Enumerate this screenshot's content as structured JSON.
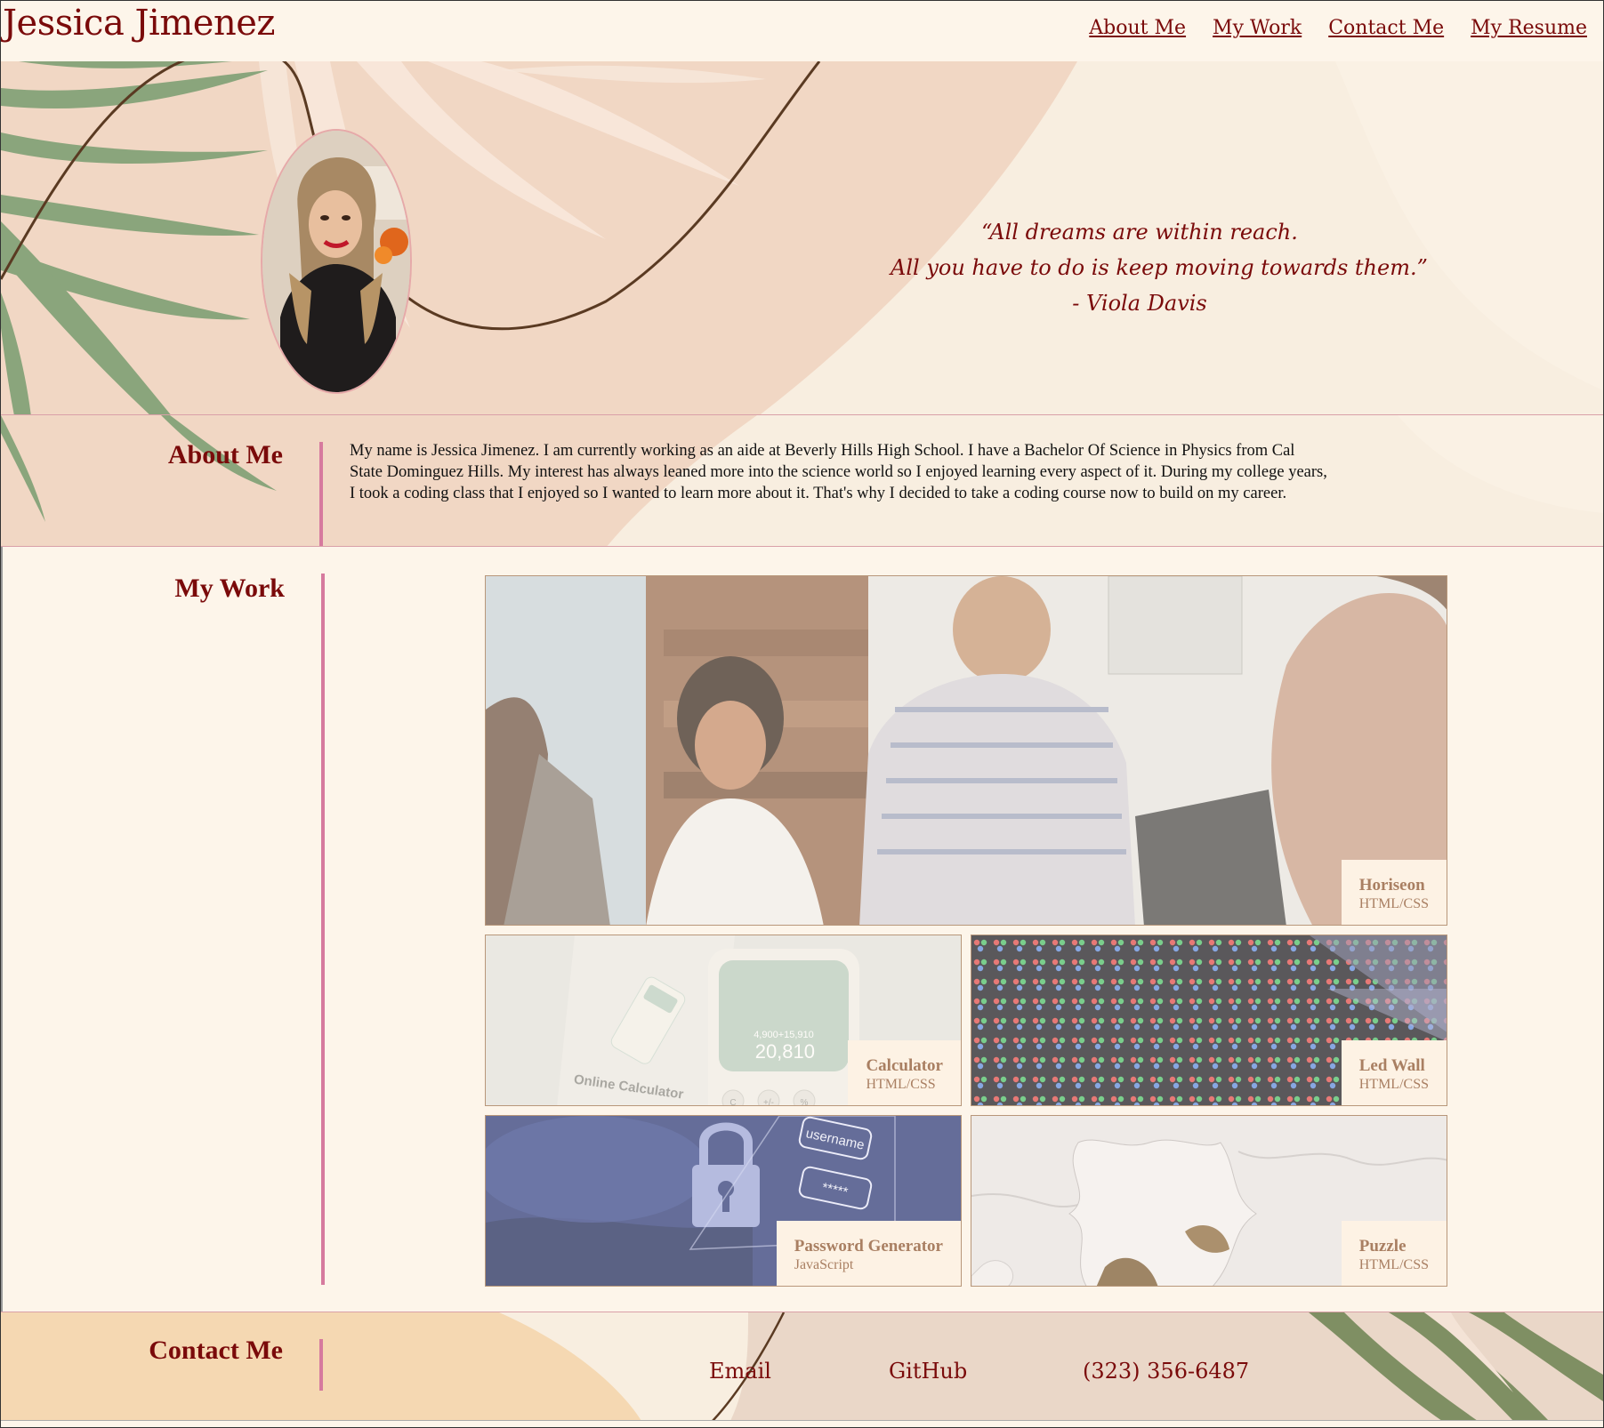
{
  "header": {
    "brand": "Jessica Jimenez",
    "nav": [
      "About Me",
      "My Work",
      "Contact Me",
      "My Resume"
    ]
  },
  "hero": {
    "quote_lines": [
      "“All dreams are within reach.",
      "All you have to do is keep moving towards them.”",
      "- Viola Davis"
    ]
  },
  "about": {
    "title": "About Me",
    "text": "My name is Jessica Jimenez. I am currently working as an aide at Beverly Hills High School. I have a Bachelor Of Science in Physics from Cal State Dominguez Hills. My interest has always leaned more into the science world so I enjoyed learning every aspect of it. During my college years, I took a coding class that I enjoyed so I wanted to learn more about it. That's why I decided to take a coding course now to build on my career."
  },
  "work": {
    "title": "My Work",
    "projects": [
      {
        "name": "Horiseon",
        "tech": "HTML/CSS"
      },
      {
        "name": "Calculator",
        "tech": "HTML/CSS",
        "image_text": {
          "heading": "Online Calculator",
          "display": "20,810",
          "display_small": "4,900+15,910",
          "keys": [
            "C",
            "+/-",
            "%"
          ]
        }
      },
      {
        "name": "Led Wall",
        "tech": "HTML/CSS"
      },
      {
        "name": "Password Generator",
        "tech": "JavaScript",
        "image_text": {
          "field1": "username",
          "field2": "*****"
        }
      },
      {
        "name": "Puzzle",
        "tech": "HTML/CSS"
      }
    ]
  },
  "contact": {
    "title": "Contact Me",
    "email": "Email",
    "github": "GitHub",
    "phone": "(323) 356-6487"
  },
  "colors": {
    "accent": "#7a0a0a",
    "bar": "#d67a9e",
    "caption": "#a97f62",
    "leaf": "#8aa57c",
    "peach": "#f0d5c0"
  }
}
